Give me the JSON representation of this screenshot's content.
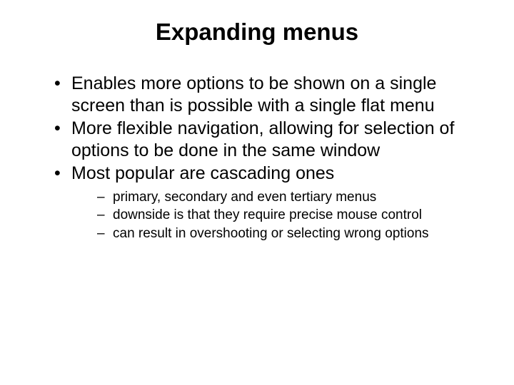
{
  "title": "Expanding menus",
  "bullets": [
    "Enables more options to be shown on a single screen than is possible with a single flat menu",
    "More flexible navigation, allowing for selection of options to be done in the same window",
    "Most popular are cascading ones"
  ],
  "subbullets": [
    "primary, secondary and even tertiary menus",
    "downside is that they require precise mouse control",
    "can result in overshooting or selecting wrong options"
  ]
}
